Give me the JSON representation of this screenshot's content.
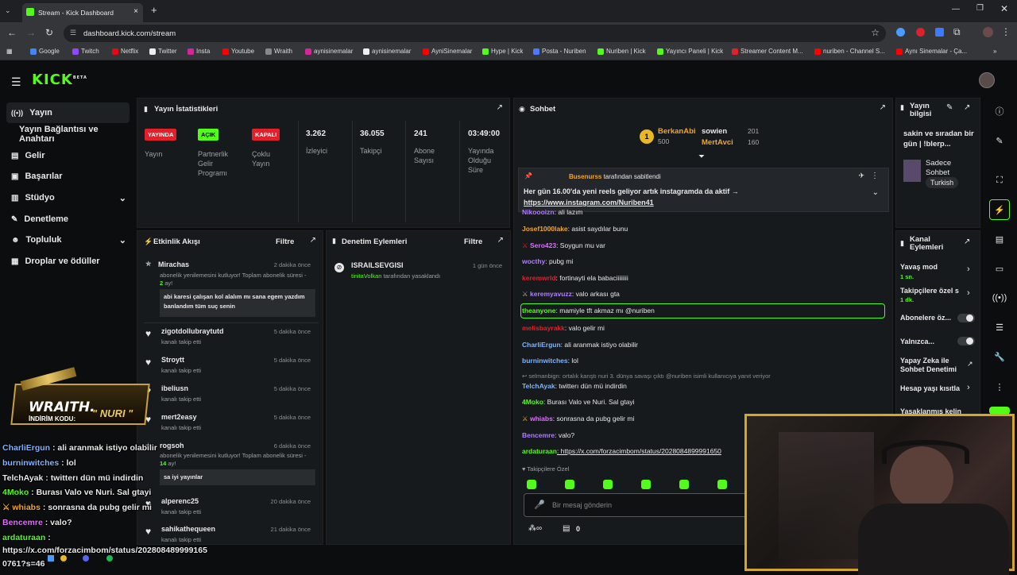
{
  "browser": {
    "tab_title": "Stream - Kick Dashboard",
    "url": "dashboard.kick.com/stream",
    "bookmarks": [
      "Google",
      "Twitch",
      "Netflix",
      "Twitter",
      "Insta",
      "Youtube",
      "Wraith",
      "aynisinemalar",
      "aynisinemalar",
      "AyniSinemalar",
      "Hype | Kick",
      "Posta - Nuriben",
      "Nuriben | Kick",
      "Yayıncı Paneli | Kick",
      "Streamer Content M...",
      "nuriben - Channel S...",
      "Aynı Sinemalar - Ça..."
    ]
  },
  "app": {
    "logo": "KICK",
    "logo_sup": "BETA"
  },
  "nav": {
    "items": [
      {
        "label": "Yayın",
        "icon": "stream-icon"
      },
      {
        "label": "Yayın Bağlantısı ve Anahtarı",
        "icon": ""
      },
      {
        "label": "Gelir",
        "icon": "revenue-icon"
      },
      {
        "label": "Başarılar",
        "icon": "achievements-icon"
      },
      {
        "label": "Stüdyo",
        "icon": "studio-icon"
      },
      {
        "label": "Denetleme",
        "icon": "moderation-icon"
      },
      {
        "label": "Topluluk",
        "icon": "community-icon"
      },
      {
        "label": "Droplar ve ödüller",
        "icon": "drops-icon"
      }
    ]
  },
  "stats": {
    "title": "Yayın İstatistikleri",
    "badges": [
      {
        "badge": "YAYINDA",
        "label": "Yayın",
        "color": "#e0202a"
      },
      {
        "badge": "AÇIK",
        "label": "Partnerlik Gelir Programı",
        "color": "#53fc18"
      },
      {
        "badge": "KAPALI",
        "label": "Çoklu Yayın",
        "color": "#e0202a"
      }
    ],
    "numbers": [
      {
        "value": "3.262",
        "label": "İzleyici"
      },
      {
        "value": "36.055",
        "label": "Takipçi"
      },
      {
        "value": "241",
        "label": "Abone Sayısı"
      },
      {
        "value": "03:49:00",
        "label": "Yayında Olduğu Süre"
      }
    ]
  },
  "activity": {
    "title": "Etkinlik Akışı",
    "filter": "Filtre",
    "items": [
      {
        "name": "Mirachas",
        "time": "2 dakika önce",
        "sub": "abonelik yenilemesini kutluyor! Toplam abonelik süresi - ",
        "months": "2",
        "suffix": " ay!",
        "msg": "abi karesi çalışan kol alalım mı sana egem yazdım banlandım tüm suç senin"
      },
      {
        "name": "zigotdollubraytutd",
        "time": "5 dakika önce",
        "sub": "kanalı takip etti"
      },
      {
        "name": "Stroytt",
        "time": "5 dakika önce",
        "sub": "kanalı takip etti"
      },
      {
        "name": "ibeliusn",
        "time": "5 dakika önce",
        "sub": "kanalı takip etti"
      },
      {
        "name": "mert2easy",
        "time": "5 dakika önce",
        "sub": "kanalı takip etti"
      },
      {
        "name": "rogsoh",
        "time": "6 dakika önce",
        "sub": "abonelik yenilemesini kutluyor! Toplam abonelik süresi - ",
        "months": "14",
        "suffix": " ay!",
        "msg": "sa iyi yayınlar"
      },
      {
        "name": "alperenc25",
        "time": "20 dakika önce",
        "sub": "kanalı takip etti"
      },
      {
        "name": "sahikathequeen",
        "time": "21 dakika önce",
        "sub": "kanalı takip etti"
      }
    ]
  },
  "moderation": {
    "title": "Denetim Eylemleri",
    "filter": "Filtre",
    "items": [
      {
        "name": "ISRAILSEVGISI",
        "time": "1 gün önce",
        "by": "tinitaVolkan",
        "action": " tarafından yasaklandı"
      }
    ]
  },
  "chat": {
    "title": "Sohbet",
    "top": [
      {
        "rank": "1",
        "name": "BerkanAbi",
        "amount": "500"
      },
      {
        "name": "sowien",
        "amount": "201"
      },
      {
        "name": "MertAvci",
        "amount": "160"
      }
    ],
    "pinned": {
      "by": "Busenurss",
      "by_suffix": " tarafından sabitlendi",
      "text": "Her gün 16.00'da yeni reels geliyor artık instagramda da aktif →",
      "link": "https://www.instagram.com/Nuriben41"
    },
    "messages": [
      {
        "user": "Nikoooizn",
        "text": ": ali lazım",
        "color": "#b07cff"
      },
      {
        "user": "Josef1000lake",
        "text": ": asist saydılar bunu",
        "color": "#f5a524"
      },
      {
        "user": "Sero423",
        "text": ": Soygun mu var",
        "color": "#e06cff"
      },
      {
        "user": "wocthy",
        "text": ": pubg mi",
        "color": "#b07cff"
      },
      {
        "user": "keremwrld",
        "text": ": fortinayti ela babaciiiiiiii",
        "color": "#e0202a"
      },
      {
        "user": "keremyavuzz",
        "text": ": valo arkası gta",
        "color": "#b07cff"
      },
      {
        "user": "theanyone",
        "text": ": mamiyle tft akmaz mı @nuriben",
        "color": "#53fc18"
      },
      {
        "user": "melisbayrakk",
        "text": ": valo gelir mi",
        "color": "#e0202a"
      },
      {
        "user": "CharliErgun",
        "text": ": ali aranmak istiyo olabilir",
        "color": "#7fb4ff"
      },
      {
        "user": "burninwitches",
        "text": ": lol",
        "color": "#7fb4ff"
      },
      {
        "user": "TelchAyak",
        "text": ": twitterı dün mü indirdin",
        "color": "#7fb4ff"
      },
      {
        "user": "4Moko",
        "text": ": Burası Valo ve Nuri. Sal gtayi",
        "color": "#53fc18"
      },
      {
        "user": "whiabs",
        "text": ": sonrasna da pubg gelir mi",
        "color": "#e06cff"
      },
      {
        "user": "Bencemre",
        "text": ": valo?",
        "color": "#b07cff"
      },
      {
        "user": "ardaturaan",
        "text": ": https://x.com/forzacimbom/status/2028084899991650",
        "color": "#53fc18"
      }
    ],
    "reply_note": "selmanbign: ortalık karıştı nuri 3. dünya savaşı çıktı @nuriben isimli kullanıcıya yanıt veriyor",
    "follower_only": "Takipçilere Özel",
    "input_placeholder": "Bir mesaj gönderin",
    "points": "0"
  },
  "stream_info": {
    "title": "Yayın bilgisi",
    "text": "sakin ve sıradan bir gün | !blerp...",
    "category": "Sadece Sohbet",
    "language": "Turkish"
  },
  "channel_actions": {
    "title": "Kanal Eylemleri",
    "items": [
      {
        "label": "Yavaş mod",
        "sub": "1 sn."
      },
      {
        "label": "Takipçilere özel s",
        "sub": "1 dk."
      },
      {
        "label": "Abonelere öz..."
      },
      {
        "label": "Yalnızca..."
      },
      {
        "label": "Yapay Zeka ile Sohbet Denetimi"
      },
      {
        "label": "Hesap yaşı kısıtla"
      },
      {
        "label": "Yasaklanmış kelin"
      }
    ]
  },
  "overlay": {
    "sponsor": "WRAITH.",
    "code_label": "İNDİRİM KODU:",
    "code": "\" NURI \"",
    "lines": [
      {
        "user": "CharliErgun",
        "text": " : ali aranmak istiyo olabilir",
        "color": "#7fb4ff"
      },
      {
        "user": "burninwitches",
        "text": " : lol",
        "color": "#7fb4ff"
      },
      {
        "user": "TelchAyak",
        "text": " : twitterı dün mü indirdin",
        "color": "#e8e8e8"
      },
      {
        "user": "4Moko",
        "text": " : Burası Valo ve Nuri. Sal gtayi",
        "color": "#53fc18"
      },
      {
        "user": "whiabs",
        "text": " : sonrasna da pubg gelir mi",
        "color": "#f5a524"
      },
      {
        "user": "Bencemre",
        "text": " : valo?",
        "color": "#e06cff"
      },
      {
        "user": "ardaturaan",
        "text": " :",
        "color": "#53fc18"
      }
    ],
    "url_line1": "https://x.com/forzacimbom/status/202808489999165",
    "url_line2": "0761?s=46"
  }
}
